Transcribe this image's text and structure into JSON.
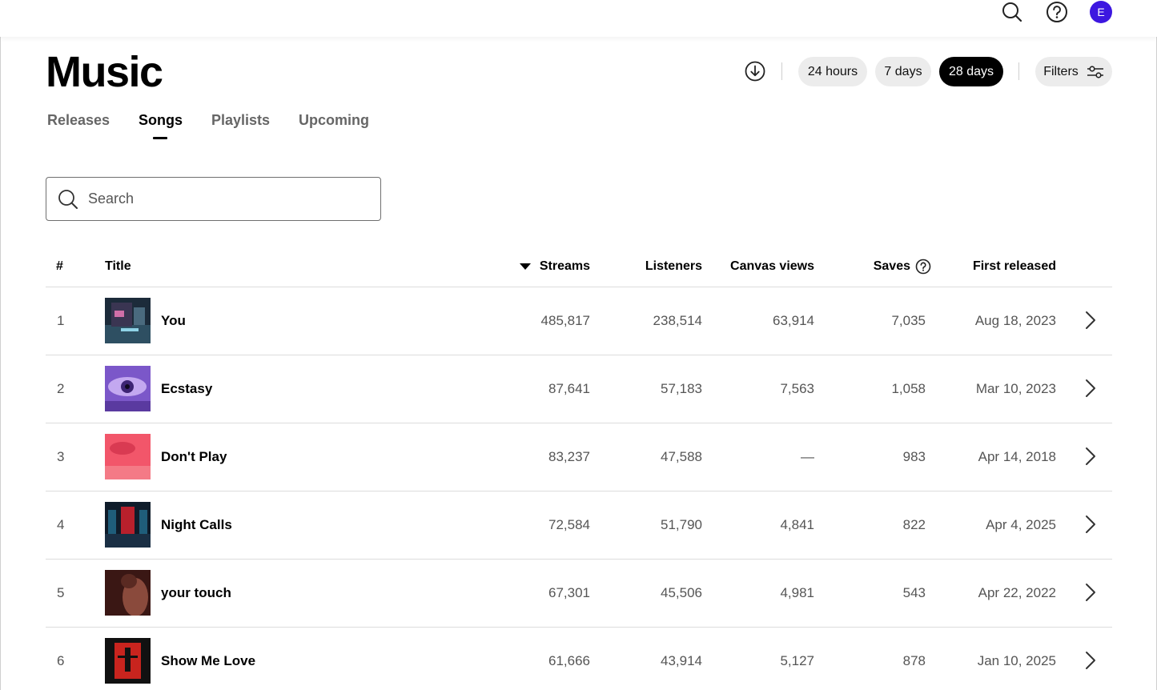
{
  "topbar": {
    "avatar_letter": "E"
  },
  "header": {
    "title": "Music",
    "time_ranges": [
      "24 hours",
      "7 days",
      "28 days"
    ],
    "active_range": "28 days",
    "filters_label": "Filters"
  },
  "tabs": [
    {
      "label": "Releases",
      "active": false
    },
    {
      "label": "Songs",
      "active": true
    },
    {
      "label": "Playlists",
      "active": false
    },
    {
      "label": "Upcoming",
      "active": false
    }
  ],
  "search": {
    "placeholder": "Search",
    "value": ""
  },
  "table": {
    "columns": {
      "index": "#",
      "title": "Title",
      "streams": "Streams",
      "listeners": "Listeners",
      "canvas_views": "Canvas views",
      "saves": "Saves",
      "first_released": "First released"
    },
    "sorted_by": "Streams",
    "sort_direction": "descending",
    "rows": [
      {
        "index": "1",
        "title": "You",
        "streams": "485,817",
        "listeners": "238,514",
        "canvas_views": "63,914",
        "saves": "7,035",
        "first_released": "Aug 18, 2023"
      },
      {
        "index": "2",
        "title": "Ecstasy",
        "streams": "87,641",
        "listeners": "57,183",
        "canvas_views": "7,563",
        "saves": "1,058",
        "first_released": "Mar 10, 2023"
      },
      {
        "index": "3",
        "title": "Don't Play",
        "streams": "83,237",
        "listeners": "47,588",
        "canvas_views": "—",
        "saves": "983",
        "first_released": "Apr 14, 2018"
      },
      {
        "index": "4",
        "title": "Night Calls",
        "streams": "72,584",
        "listeners": "51,790",
        "canvas_views": "4,841",
        "saves": "822",
        "first_released": "Apr 4, 2025"
      },
      {
        "index": "5",
        "title": "your touch",
        "streams": "67,301",
        "listeners": "45,506",
        "canvas_views": "4,981",
        "saves": "543",
        "first_released": "Apr 22, 2022"
      },
      {
        "index": "6",
        "title": "Show Me Love",
        "streams": "61,666",
        "listeners": "43,914",
        "canvas_views": "5,127",
        "saves": "878",
        "first_released": "Jan 10, 2025"
      }
    ]
  },
  "colors": {
    "accent_avatar": "#3d17e0",
    "active_pill": "#000000",
    "pill": "#ececec"
  }
}
